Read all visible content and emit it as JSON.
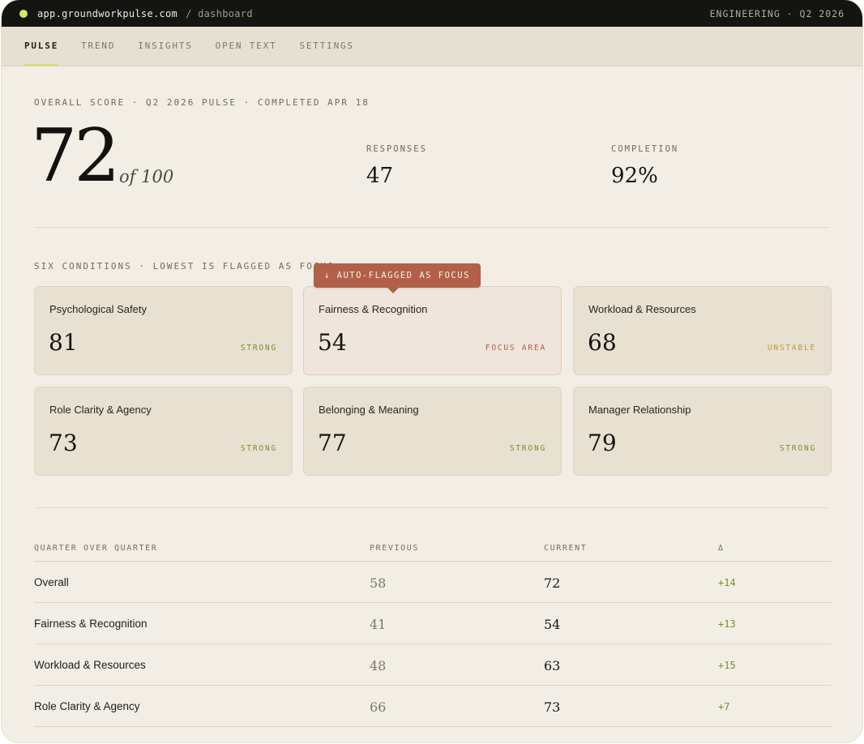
{
  "titlebar": {
    "url": "app.groundworkpulse.com",
    "path": "/ dashboard",
    "right": "ENGINEERING · Q2 2026"
  },
  "tabs": [
    {
      "label": "PULSE",
      "active": true
    },
    {
      "label": "TREND"
    },
    {
      "label": "INSIGHTS"
    },
    {
      "label": "OPEN TEXT"
    },
    {
      "label": "SETTINGS"
    }
  ],
  "overall": {
    "label": "OVERALL SCORE · Q2 2026 PULSE · COMPLETED APR 18",
    "score": "72",
    "suffix": "of 100",
    "responses_label": "RESPONSES",
    "responses": "47",
    "completion_label": "COMPLETION",
    "completion": "92%"
  },
  "conditions": {
    "label": "SIX CONDITIONS · LOWEST IS FLAGGED AS FOCUS",
    "flag": "↓ AUTO-FLAGGED AS FOCUS",
    "cards": [
      {
        "name": "Psychological Safety",
        "score": "81",
        "status": "STRONG"
      },
      {
        "name": "Fairness & Recognition",
        "score": "54",
        "status": "FOCUS AREA"
      },
      {
        "name": "Workload & Resources",
        "score": "68",
        "status": "UNSTABLE"
      },
      {
        "name": "Role Clarity & Agency",
        "score": "73",
        "status": "STRONG"
      },
      {
        "name": "Belonging & Meaning",
        "score": "77",
        "status": "STRONG"
      },
      {
        "name": "Manager Relationship",
        "score": "79",
        "status": "STRONG"
      }
    ]
  },
  "qoq": {
    "headers": [
      "QUARTER OVER QUARTER",
      "PREVIOUS",
      "CURRENT",
      "Δ"
    ],
    "rows": [
      {
        "label": "Overall",
        "previous": "58",
        "current": "72",
        "delta": "+14"
      },
      {
        "label": "Fairness & Recognition",
        "previous": "41",
        "current": "54",
        "delta": "+13"
      },
      {
        "label": "Workload & Resources",
        "previous": "48",
        "current": "63",
        "delta": "+15"
      },
      {
        "label": "Role Clarity & Agency",
        "previous": "66",
        "current": "73",
        "delta": "+7"
      }
    ]
  },
  "colors": {
    "accent": "#d2e26a",
    "focus": "#b3604a",
    "strong": "#79902b",
    "unstable": "#c29a3b"
  }
}
